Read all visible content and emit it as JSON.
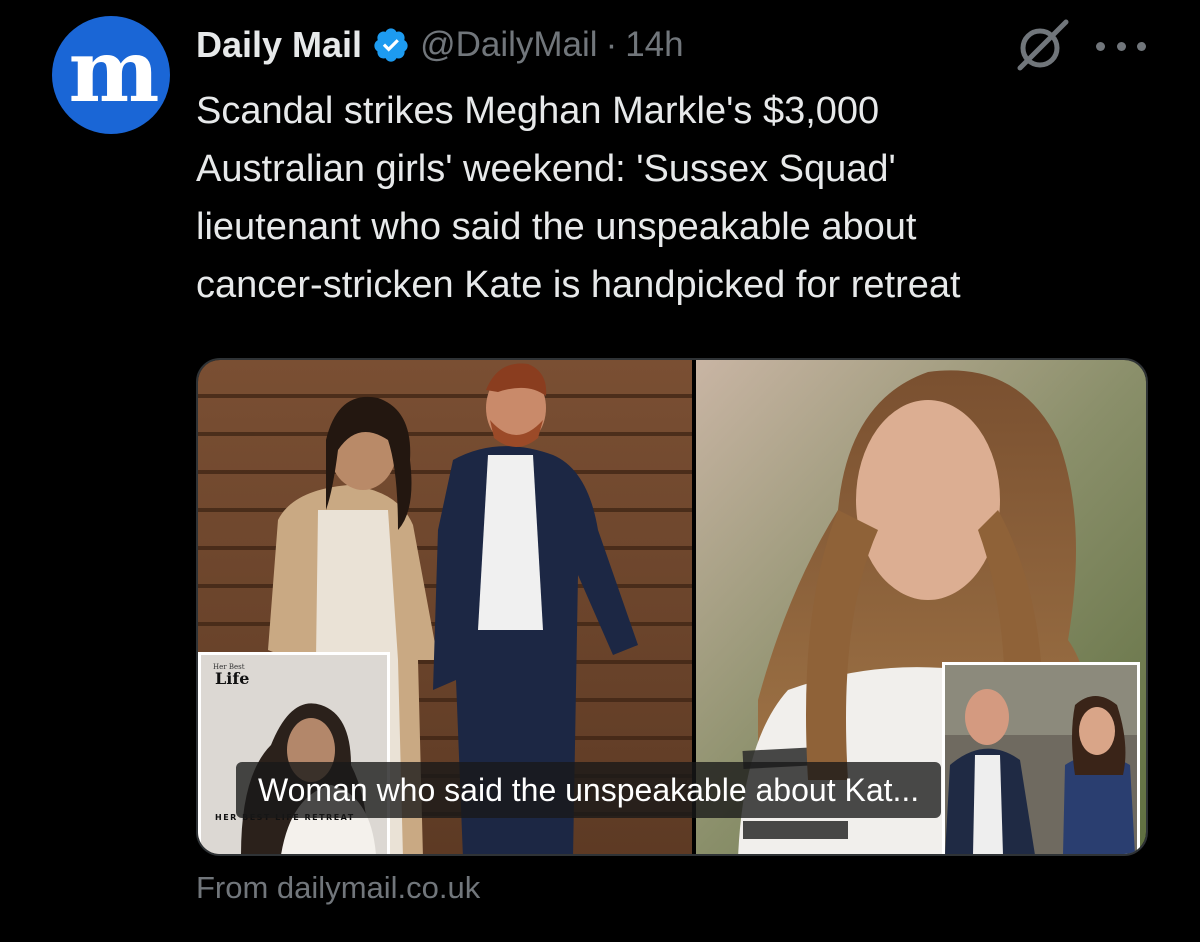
{
  "account": {
    "display_name": "Daily Mail",
    "handle": "@DailyMail",
    "separator": "·",
    "time": "14h",
    "avatar_icon": "daily-mail-m-logo",
    "avatar_color": "#1a66d6",
    "verified_color": "#1d9bf0"
  },
  "tweet": {
    "text": "Scandal strikes Meghan Markle's $3,000\nAustralian girls' weekend: 'Sussex Squad'\nlieutenant who said the unspeakable about\ncancer-stricken Kate is handpicked for retreat"
  },
  "media": {
    "caption": "Woman who said the unspeakable about Kat...",
    "inset_magazine_logo": "Life",
    "inset_magazine_header": "Her Best",
    "inset_magazine_footer": "HER BEST LIFE RETREAT"
  },
  "link_card": {
    "source": "From dailymail.co.uk"
  },
  "icons": {
    "grok": "grok-icon",
    "more": "more-options-icon",
    "verified": "verified-badge-icon"
  }
}
